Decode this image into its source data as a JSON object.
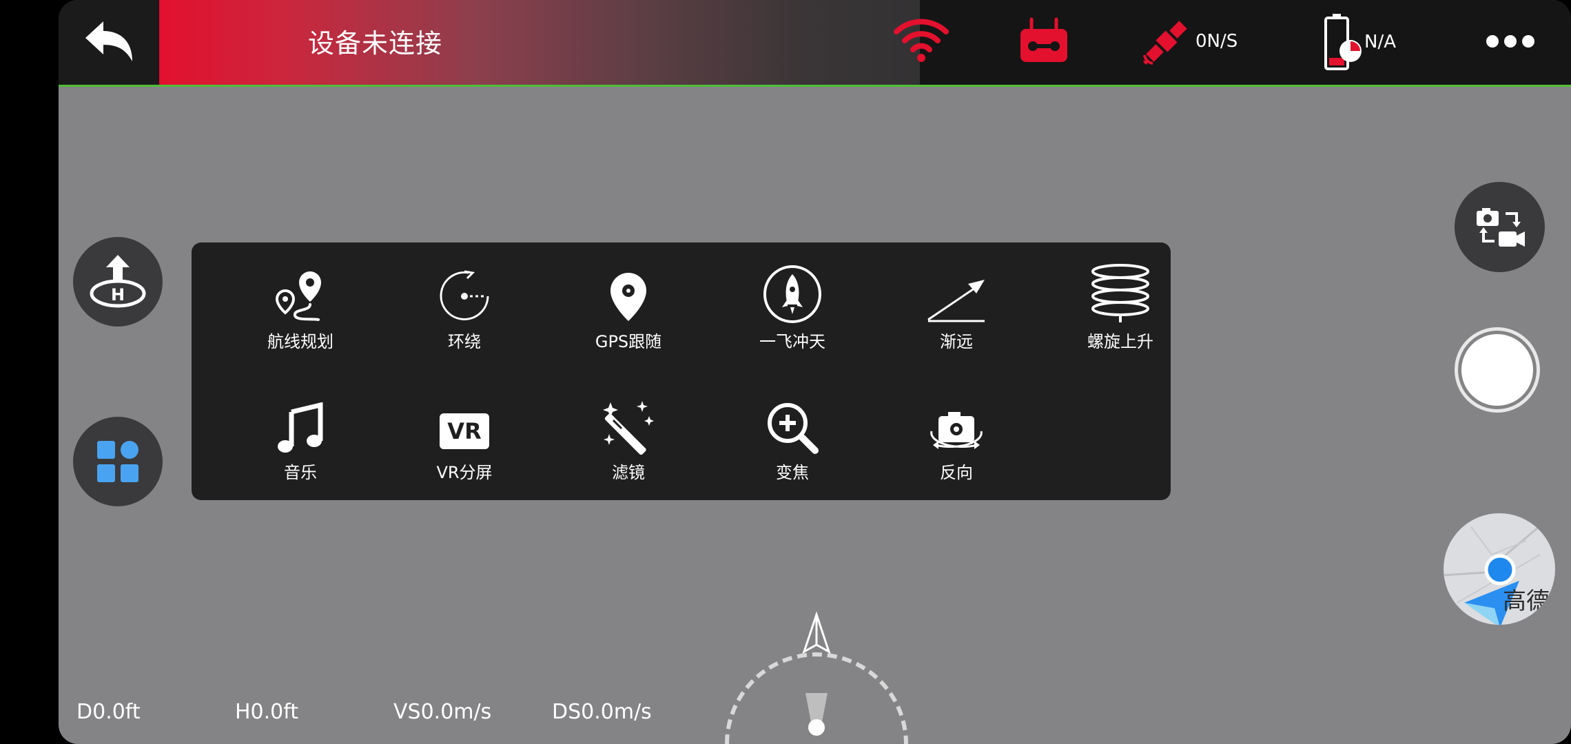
{
  "header": {
    "status_text": "设备未连接",
    "gps_speed": "0N/S",
    "battery_text": "N/A",
    "accent_color": "#e3102e"
  },
  "modes": [
    {
      "label": "航线规划",
      "icon": "route-plan-icon"
    },
    {
      "label": "环绕",
      "icon": "orbit-icon"
    },
    {
      "label": "GPS跟随",
      "icon": "gps-follow-icon"
    },
    {
      "label": "一飞冲天",
      "icon": "rocket-icon"
    },
    {
      "label": "渐远",
      "icon": "dronie-icon"
    },
    {
      "label": "螺旋上升",
      "icon": "spiral-icon"
    },
    {
      "label": "音乐",
      "icon": "music-icon"
    },
    {
      "label": "VR分屏",
      "icon": "vr-icon"
    },
    {
      "label": "滤镜",
      "icon": "filter-wand-icon"
    },
    {
      "label": "变焦",
      "icon": "zoom-icon"
    },
    {
      "label": "反向",
      "icon": "reverse-camera-icon"
    }
  ],
  "vr_badge": "VR",
  "telemetry": {
    "distance": "D0.0ft",
    "height": "H0.0ft",
    "vertical_speed": "VS0.0m/s",
    "horizontal_speed": "DS0.0m/s"
  },
  "map": {
    "brand": "高德"
  }
}
